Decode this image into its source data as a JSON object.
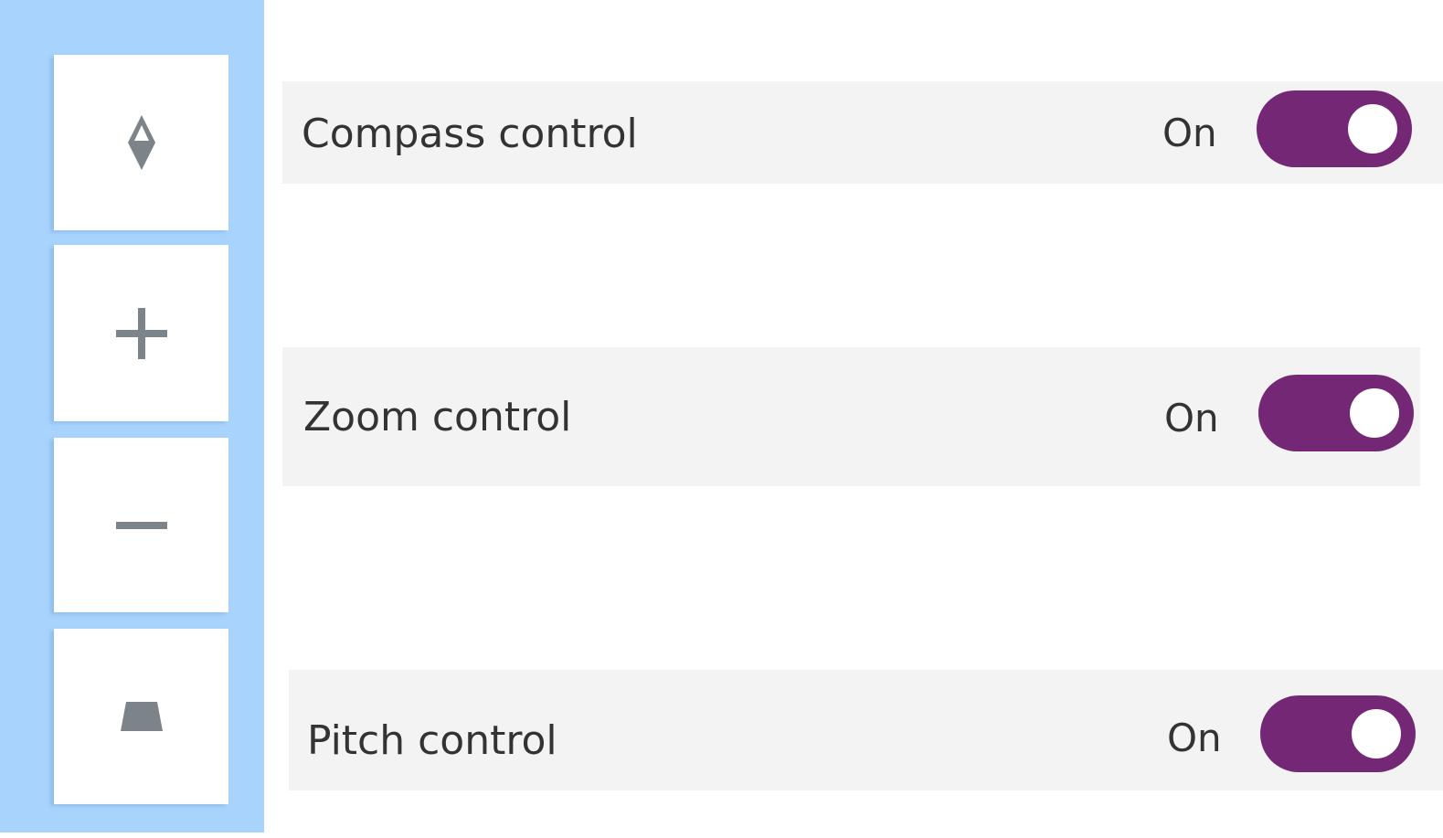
{
  "map_controls": {
    "buttons": [
      {
        "name": "compass",
        "icon": "compass-icon"
      },
      {
        "name": "zoom-in",
        "icon": "plus-icon"
      },
      {
        "name": "zoom-out",
        "icon": "minus-icon"
      },
      {
        "name": "pitch",
        "icon": "pitch-icon"
      }
    ],
    "icon_color": "#7d8489",
    "panel_color": "#a8d3fd"
  },
  "settings": [
    {
      "label": "Compass control",
      "state": "On",
      "enabled": true
    },
    {
      "label": "Zoom control",
      "state": "On",
      "enabled": true
    },
    {
      "label": "Pitch control",
      "state": "On",
      "enabled": true
    }
  ],
  "colors": {
    "toggle_on": "#742774",
    "row_background": "#f3f3f3",
    "text": "#333333"
  }
}
